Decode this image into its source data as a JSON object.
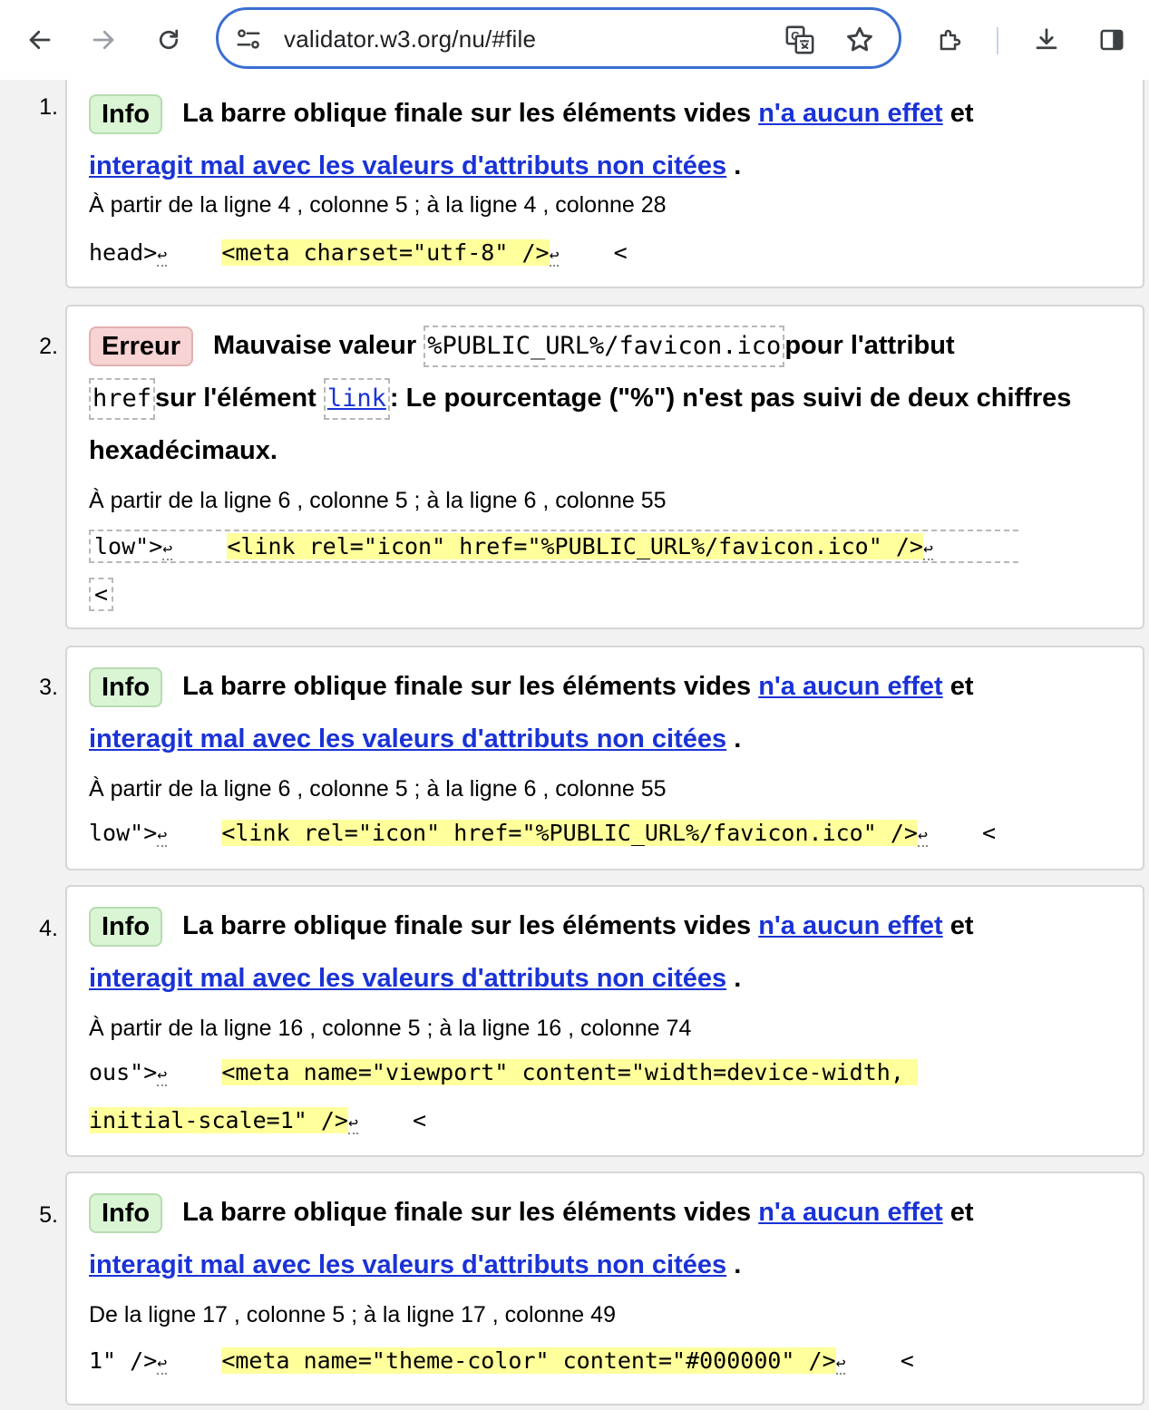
{
  "browser": {
    "url": "validator.w3.org/nu/#file"
  },
  "messages": [
    {
      "num": "1.",
      "badge": "Info",
      "text_a": "La barre oblique finale sur les éléments vides",
      "link_1": "n'a aucun effet",
      "text_b": "et",
      "link_2": "interagit mal avec les valeurs d'attributs non citées",
      "text_c": ".",
      "location": "À partir de la ligne 4 , colonne 5 ; à la ligne 4 , colonne 28",
      "ext_before": "head>",
      "lf": "↩",
      "ext_hl": "<meta charset=\"utf-8\" />",
      "ext_after": "<"
    },
    {
      "num": "2.",
      "badge": "Erreur",
      "text_a": "Mauvaise valeur",
      "code_1": "%PUBLIC_URL%/favicon.ico",
      "text_b": "pour l'attribut",
      "code_2": "href",
      "text_c": "sur l'élément",
      "code_3": "link",
      "text_d": ": Le pourcentage (\"%\") n'est pas suivi de deux chiffres hexadécimaux.",
      "location": "À partir de la ligne 6 , colonne 5 ; à la ligne 6 , colonne 55",
      "ext_before": "low\">",
      "lf": "↩",
      "ext_hl": "<link rel=\"icon\" href=\"%PUBLIC_URL%/favicon.ico\" />",
      "ext_after": "<"
    },
    {
      "num": "3.",
      "badge": "Info",
      "text_a": "La barre oblique finale sur les éléments vides",
      "link_1": "n'a aucun effet",
      "text_b": "et",
      "link_2": "interagit mal avec les valeurs d'attributs non citées",
      "text_c": ".",
      "location": "À partir de la ligne 6 , colonne 5 ; à la ligne 6 , colonne 55",
      "ext_before": "low\">",
      "lf": "↩",
      "ext_hl": "<link rel=\"icon\" href=\"%PUBLIC_URL%/favicon.ico\" />",
      "ext_after": "<"
    },
    {
      "num": "4.",
      "badge": "Info",
      "text_a": "La barre oblique finale sur les éléments vides",
      "link_1": "n'a aucun effet",
      "text_b": "et",
      "link_2": "interagit mal avec les valeurs d'attributs non citées",
      "text_c": ".",
      "location": "À partir de la ligne 16 , colonne 5 ; à la ligne 16 , colonne 74",
      "ext_before": "ous\">",
      "lf": "↩",
      "ext_hl": "<meta name=\"viewport\" content=\"width=device-width, ",
      "ext_hl_2": "initial-scale=1\" />",
      "ext_after": "<"
    },
    {
      "num": "5.",
      "badge": "Info",
      "text_a": "La barre oblique finale sur les éléments vides",
      "link_1": "n'a aucun effet",
      "text_b": "et",
      "link_2": "interagit mal avec les valeurs d'attributs non citées",
      "text_c": ".",
      "location": "De la ligne 17 , colonne 5 ; à la ligne 17 , colonne 49",
      "ext_before": "1\" />",
      "lf": "↩",
      "ext_hl": "<meta name=\"theme-color\" content=\"#000000\" />",
      "ext_after": "<"
    }
  ]
}
